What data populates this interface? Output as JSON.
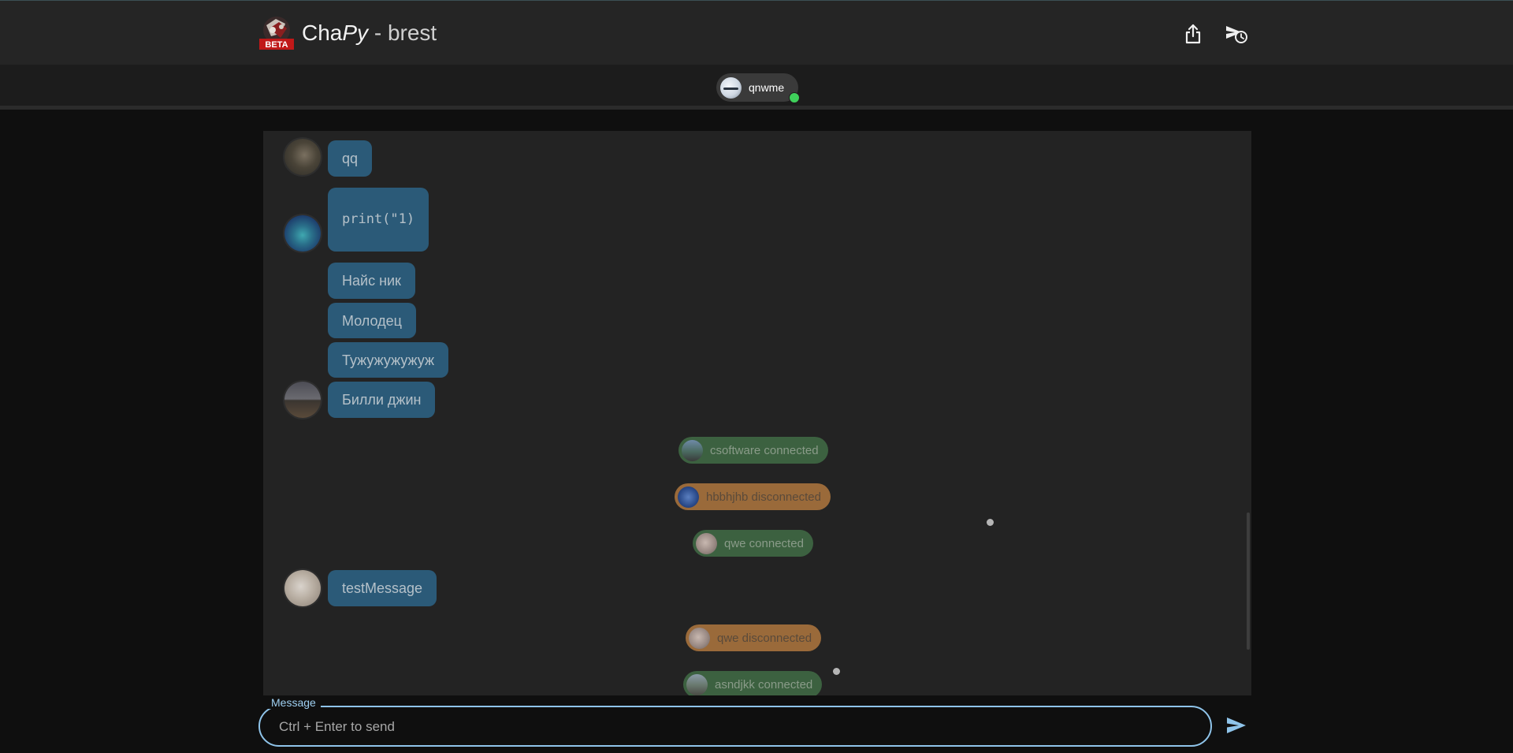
{
  "header": {
    "brand_cha": "Cha",
    "brand_py": "Py",
    "room_name": "- brest",
    "logo_badge": "BETA",
    "share_icon": "share-icon",
    "leave_icon": "send-clock-icon"
  },
  "online_users": [
    {
      "name": "qnwme",
      "status": "online"
    }
  ],
  "messages": [
    {
      "type": "message",
      "text": "qq"
    },
    {
      "type": "message",
      "text": "print(\"1)"
    },
    {
      "type": "message",
      "text": "Найс ник"
    },
    {
      "type": "message",
      "text": "Молодец"
    },
    {
      "type": "message",
      "text": "Тужужужужуж"
    },
    {
      "type": "message",
      "text": "Билли джин"
    },
    {
      "type": "event",
      "text": "csoftware connected",
      "kind": "connected"
    },
    {
      "type": "event",
      "text": "hbbhjhb disconnected",
      "kind": "disconnected"
    },
    {
      "type": "event",
      "text": "qwe connected",
      "kind": "connected"
    },
    {
      "type": "message",
      "text": "testMessage"
    },
    {
      "type": "event",
      "text": "qwe disconnected",
      "kind": "disconnected"
    },
    {
      "type": "event",
      "text": "asndjkk connected",
      "kind": "connected"
    }
  ],
  "composer": {
    "label": "Message",
    "placeholder": "Ctrl + Enter to send",
    "value": "",
    "send_icon": "send-icon"
  },
  "colors": {
    "message_bubble": "#2b5a78",
    "event_connected": "#3c6140",
    "event_disconnected": "#9a6a3a",
    "online_indicator": "#3fd05b",
    "input_border": "#8fc4ea"
  }
}
